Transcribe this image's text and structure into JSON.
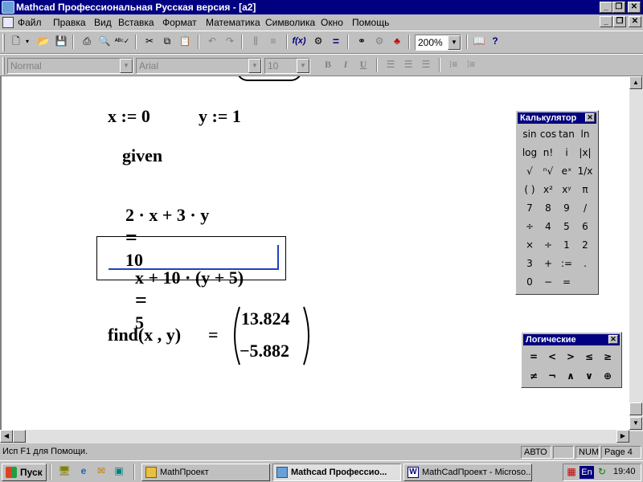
{
  "window": {
    "title": "Mathcad Профессиональная Русская версия - [a2]"
  },
  "menu": {
    "items": [
      "Файл",
      "Правка",
      "Вид",
      "Вставка",
      "Формат",
      "Математика",
      "Символика",
      "Окно",
      "Помощь"
    ]
  },
  "toolbar": {
    "zoom": "200%"
  },
  "format_toolbar": {
    "style": "Normal",
    "font": "Arial",
    "size": "10",
    "bold": "B",
    "italic": "I",
    "underline": "U"
  },
  "worksheet": {
    "x_def": "x := 0",
    "y_def": "y := 1",
    "given": "given",
    "eq1_lhs": "2 · x + 3 · y",
    "eq1_op": "=",
    "eq1_rhs": "10",
    "eq2_lhs": "x + 10 · (y + 5)",
    "eq2_op": "=",
    "eq2_rhs": "5",
    "find_expr": "find(x , y)",
    "find_eq": "=",
    "result": [
      "13.824",
      "−5.882"
    ]
  },
  "calculator": {
    "title": "Калькулятор",
    "rows": [
      [
        "sin",
        "cos",
        "tan",
        "ln"
      ],
      [
        "log",
        "n!",
        "i",
        "|x|"
      ],
      [
        "√",
        "ⁿ√",
        "eˣ",
        "1/x"
      ],
      [
        "( )",
        "x²",
        "xʸ",
        "π"
      ],
      [
        "7",
        "8",
        "9",
        "/"
      ],
      [
        "÷",
        "4",
        "5",
        "6"
      ],
      [
        "×",
        "÷",
        "1",
        "2"
      ],
      [
        "3",
        "+",
        ":=",
        "."
      ],
      [
        "0",
        "−",
        "=",
        ""
      ]
    ]
  },
  "logic": {
    "title": "Логические",
    "rows": [
      [
        "=",
        "<",
        ">",
        "≤",
        "≥"
      ],
      [
        "≠",
        "¬",
        "∧",
        "∨",
        "⊕"
      ]
    ]
  },
  "statusbar": {
    "help": "Исп F1 для Помощи.",
    "mode": "АВТО",
    "num": "NUM",
    "page": "Page 4"
  },
  "taskbar": {
    "start": "Пуск",
    "tasks": [
      "MathПроект",
      "Mathcad Профессио...",
      "MathCadПроект - Microso..."
    ],
    "lang": "En",
    "time": "19:40"
  }
}
